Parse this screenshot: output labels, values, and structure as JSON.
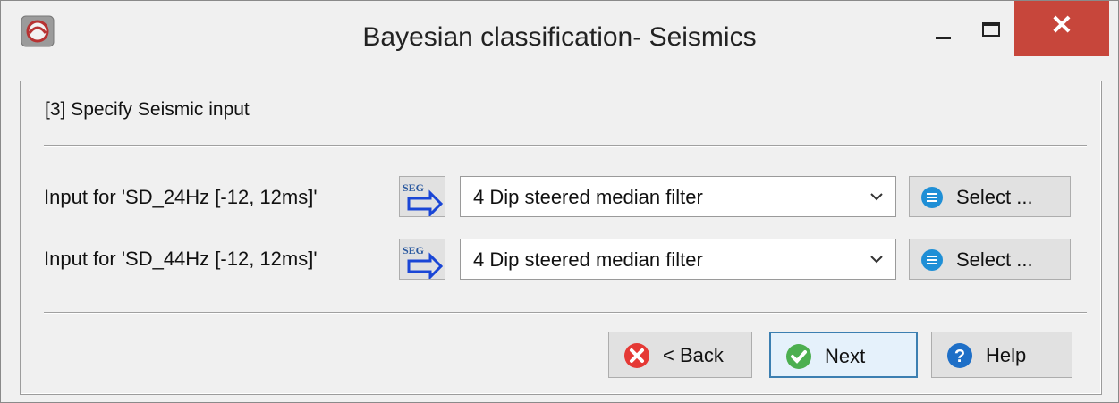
{
  "window": {
    "title": "Bayesian classification- Seismics",
    "close_glyph": "✕",
    "icons": {
      "app": "app-logo-icon",
      "minimize": "minimize-icon",
      "maximize": "maximize-icon",
      "close": "close-icon"
    },
    "accent_close": "#c7463b"
  },
  "step": {
    "label": "[3] Specify Seismic input"
  },
  "inputs": [
    {
      "label": "Input for 'SD_24Hz [-12, 12ms]'",
      "selected": "4 Dip steered median filter",
      "select_label": "Select ..."
    },
    {
      "label": "Input for 'SD_44Hz [-12, 12ms]'",
      "selected": "4 Dip steered median filter",
      "select_label": "Select ..."
    }
  ],
  "seg_icon": {
    "name": "seg-import-icon",
    "text": "SEG"
  },
  "buttons": {
    "back": "< Back",
    "next": "Next",
    "help": "Help"
  },
  "colors": {
    "back": "#e53935",
    "next": "#4caf50",
    "help": "#1e6fc7",
    "select": "#1f8fd6"
  }
}
